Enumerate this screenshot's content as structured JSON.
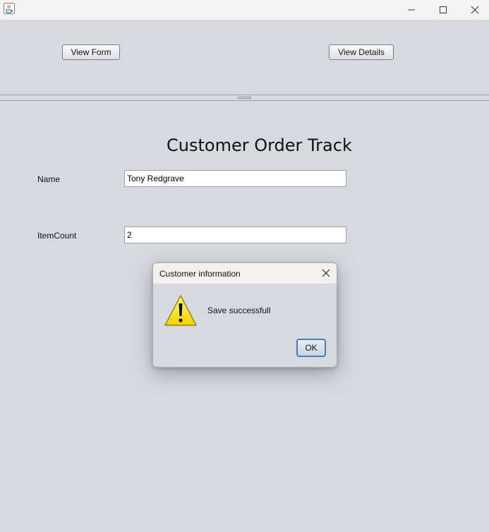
{
  "window": {
    "app_icon": "java-icon",
    "controls": [
      "minimize-icon",
      "maximize-icon",
      "close-icon"
    ]
  },
  "top_panel": {
    "view_form_label": "View Form",
    "view_details_label": "View Details"
  },
  "form": {
    "title": "Customer Order Track",
    "name_label": "Name",
    "name_value": "Tony Redgrave",
    "itemcount_label": "ItemCount",
    "itemcount_value": "2"
  },
  "dialog": {
    "title": "Customer information",
    "message": "Save successfull",
    "ok_label": "OK",
    "icon": "warning-icon",
    "accent_color": "#4f7bb5"
  }
}
